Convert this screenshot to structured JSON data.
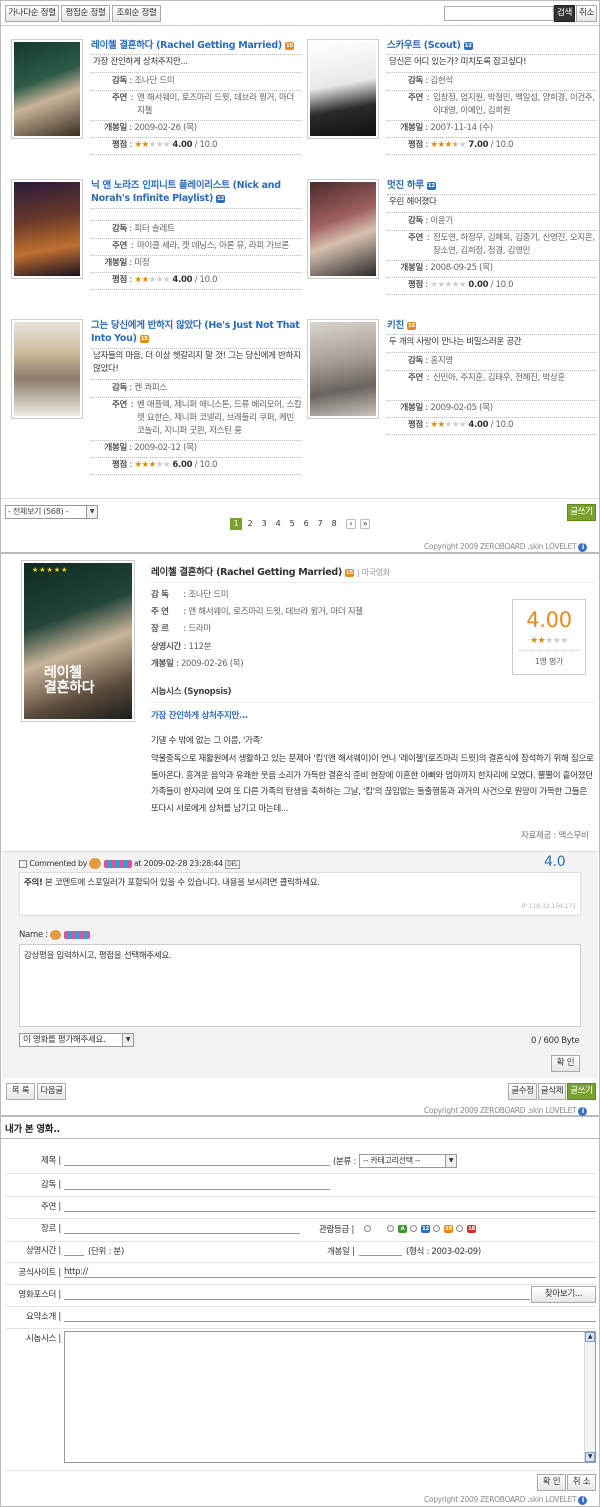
{
  "list": {
    "sort_buttons": [
      "가나다순 정렬",
      "평점순 정렬",
      "조회순 정렬"
    ],
    "search_button": "검색",
    "cancel_button": "취소",
    "movies": [
      {
        "title": "레이첼 결혼하다 (Rachel Getting Married)",
        "badge": "15",
        "badge_color": "#e88a1a",
        "tagline": "가장 잔인하게 상처주지만...",
        "director_label": "감독",
        "director": "조나단 드미",
        "cast_label": "주연",
        "cast": "앤 해서웨이, 로즈마리 드윗, 데브라 윙거, 마더 지첼",
        "release_label": "개봉일",
        "release": "2009-02-26 (목)",
        "rating_label": "평점",
        "rating_value": "4.00",
        "rating_max": " / 10.0",
        "stars_on": 2,
        "stars_half": 0
      },
      {
        "title": "스카우트 (Scout)",
        "badge": "12",
        "badge_color": "#2b6fbe",
        "tagline": "당신은 어디 있는가? 미치도록 잡고싶다!",
        "director_label": "감독",
        "director": "김현석",
        "cast_label": "주연",
        "cast": "임창정, 엄지원, 박철민, 백일섭, 양희경, 이건주, 이대영, 이예인, 김희원",
        "release_label": "개봉일",
        "release": "2007-11-14 (수)",
        "rating_label": "평점",
        "rating_value": "7.00",
        "rating_max": " / 10.0",
        "stars_on": 3,
        "stars_half": 1
      },
      {
        "title": "닉 앤 노라즈 인피니트 플레이리스트 (Nick and Norah's Infinite Playlist)",
        "badge": "12",
        "badge_color": "#2b6fbe",
        "tagline": "",
        "director_label": "감독",
        "director": "피터 솔레트",
        "cast_label": "주연",
        "cast": "마이클 세라, 캣 데닝스, 아론 유, 라피 가브론",
        "release_label": "개봉일",
        "release": "미정",
        "rating_label": "평점",
        "rating_value": "4.00",
        "rating_max": " / 10.0",
        "stars_on": 2,
        "stars_half": 0
      },
      {
        "title": "멋진 하루",
        "badge": "12",
        "badge_color": "#2b6fbe",
        "tagline": "우린 헤어졌다",
        "director_label": "감독",
        "director": "이윤기",
        "cast_label": "주연",
        "cast": "전도연, 하정우, 김혜옥, 김중기, 신영진, 오지은, 장소연, 김희정, 정경, 김영민",
        "release_label": "개봉일",
        "release": "2008-09-25 (목)",
        "rating_label": "평점",
        "rating_value": "0.00",
        "rating_max": " / 10.0",
        "stars_on": 0,
        "stars_half": 0
      },
      {
        "title": "그는 당신에게 반하지 않았다 (He's Just Not That Into You)",
        "badge": "15",
        "badge_color": "#e88a1a",
        "tagline": "남자들의 마음, 더 이상 헷갈리지 말 것! 그는 당신에게 반하지 않았다!",
        "director_label": "감독",
        "director": "켄 콰피스",
        "cast_label": "주연",
        "cast": "벤 애플렉, 제니퍼 애니스톤, 드류 베리모어, 스칼렛 요한슨, 제니퍼 코넬리, 브래들리 쿠퍼, 케빈 코놀리, 지니퍼 굿윈, 저스틴 롱",
        "release_label": "개봉일",
        "release": "2009-02-12 (목)",
        "rating_label": "평점",
        "rating_value": "6.00",
        "rating_max": " / 10.0",
        "stars_on": 3,
        "stars_half": 0
      },
      {
        "title": "키친",
        "badge": "15",
        "badge_color": "#e88a1a",
        "tagline": "두 개의 사랑이 만나는 비밀스러운 공간",
        "director_label": "감독",
        "director": "홍지영",
        "cast_label": "주연",
        "cast": "신민아, 주지훈, 김태우, 전혜진, 박상훈",
        "release_label": "개봉일",
        "release": "2009-02-05 (목)",
        "rating_label": "평점",
        "rating_value": "4.00",
        "rating_max": " / 10.0",
        "stars_on": 2,
        "stars_half": 0
      }
    ],
    "category_select": "- 전체보기 (568) -",
    "write_button": "글쓰기",
    "pages": [
      "1",
      "2",
      "3",
      "4",
      "5",
      "6",
      "7",
      "8"
    ],
    "current_page": "1",
    "copyright": "Copyright 2009 ZEROBOARD .skin LOVELET"
  },
  "detail": {
    "title": "레이첼 결혼하다 (Rachel Getting Married)",
    "badge": "15",
    "country": "미국영화",
    "director_label": "감 독",
    "director": "조나단 드미",
    "cast_label": "주 연",
    "cast": "앤 해서웨이, 로즈마리 드윗, 데브라 윙거, 마더 지첼",
    "genre_label": "장 르",
    "genre": "드라마",
    "runtime_label": "상영시간",
    "runtime": "112분",
    "release_label": "개봉일",
    "release": "2009-02-26 (목)",
    "rating_box_value": "4.00",
    "rating_box_count": "1명 평가",
    "synopsis_heading": "시놉시스 (Synopsis)",
    "synopsis_tagline": "가장 잔인하게 상처주지만...",
    "synopsis_lead": "기댈 수 밖에 없는 그 이름, '가족'",
    "synopsis_body": "약물중독으로 재활원에서 생활하고 있는 문제아 '킴'(앤 해서웨이)이 언니 '레이첼'(로즈마리 드윗)의 결혼식에 참석하기 위해 집으로 돌아온다. 흥겨운 음악과 유쾌한 웃음 소리가 가득한 결혼식 준비 현장에 이혼한 아빠와 엄마까지 한자리에 모였다. 뿔뿔이 흩어졌던 가족들이 한자리에 모여 또 다른 가족의 탄생을 축하하는 그날, '킴'의 끊임없는 돌출행동과 과거의 사건으로 원망이 가득한 그들은 또다시 서로에게 상처를 남기고 마는데...",
    "source": "자료제공 : 맥스무비",
    "comment_by": "Commented by",
    "comment_time": "at 2009-02-28 23:28:44",
    "comment_del": "DEL",
    "comment_score": "4.0",
    "comment_warning_bold": "주의!",
    "comment_warning": " 본 코멘트에 스포일러가 포함되어 있을 수 있습니다. 내용을 보시려면 클릭하세요.",
    "comment_ip": "IP 118.32.156.171",
    "name_label": "Name :",
    "comment_placeholder": "감상평을 입력하시고, 평점을 선택해주세요.",
    "rate_select": "이 영화를 평가해주세요.",
    "byte_counter": "0 / 600 Byte",
    "confirm_button": "확 인",
    "list_button": "목 록",
    "next_button": "다음글",
    "edit_button": "글수정",
    "delete_button": "글삭제",
    "write_button": "글쓰기",
    "copyright": "Copyright 2009 ZEROBOARD .skin LOVELET"
  },
  "form": {
    "heading": "내가 본 영화..",
    "title_label": "제목 |",
    "category_label": "(분류 :",
    "category_select": "-- 카테고리선택 --",
    "director_label": "감독 |",
    "cast_label": "주연 |",
    "genre_label": "장르 |",
    "age_label": "관람등급 |",
    "age_options": [
      {
        "label": "",
        "color": "#fff"
      },
      {
        "label": "A",
        "color": "#3a9a2a"
      },
      {
        "label": "12",
        "color": "#2b6fbe"
      },
      {
        "label": "15",
        "color": "#e88a1a"
      },
      {
        "label": "18",
        "color": "#d0322a"
      }
    ],
    "runtime_label": "상영시간 |",
    "runtime_unit": "(단위 : 분)",
    "release_label": "개봉일 |",
    "release_hint": "(형식 : 2003-02-09)",
    "site_label": "공식사이트 |",
    "site_value": "http://",
    "poster_label": "영화포스터 |",
    "browse_button": "찾아보기...",
    "summary_label": "요약소개 |",
    "synopsis_label": "시놉시스 |",
    "confirm_button": "확 인",
    "cancel_button": "취 소",
    "copyright": "Copyright 2009 ZEROBOARD .skin LOVELET"
  }
}
